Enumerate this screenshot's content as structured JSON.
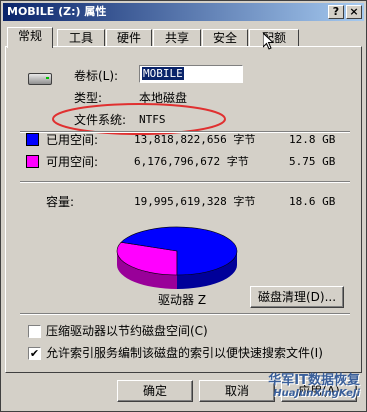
{
  "window": {
    "title": "MOBILE (Z:) 属性",
    "help_glyph": "?",
    "close_glyph": "×"
  },
  "tabs": [
    {
      "label": "常规"
    },
    {
      "label": "工具"
    },
    {
      "label": "硬件"
    },
    {
      "label": "共享"
    },
    {
      "label": "安全"
    },
    {
      "label": "配额"
    }
  ],
  "general": {
    "label_label": "卷标(L):",
    "label_value": "MOBILE",
    "type_label": "类型:",
    "type_value": "本地磁盘",
    "fs_label": "文件系统:",
    "fs_value": "NTFS",
    "used_label": "已用空间:",
    "used_bytes": "13,818,822,656 字节",
    "used_gb": "12.8 GB",
    "free_label": "可用空间:",
    "free_bytes": "6,176,796,672 字节",
    "free_gb": "5.75 GB",
    "capacity_label": "容量:",
    "capacity_bytes": "19,995,619,328 字节",
    "capacity_gb": "18.6 GB",
    "drive_label": "驱动器 Z",
    "cleanup_button": "磁盘清理(D)...",
    "compress_label": "压缩驱动器以节约磁盘空间(C)",
    "compress_checked": false,
    "index_label": "允许索引服务编制该磁盘的索引以便快速搜索文件(I)",
    "index_checked": true
  },
  "pie": {
    "used_fraction": 0.691,
    "used_color": "#0000ff",
    "free_color": "#ff00ff"
  },
  "buttons": {
    "ok": "确定",
    "cancel": "取消",
    "apply": "应用(A)"
  },
  "watermark": {
    "line1": "华军IT数据恢复",
    "line2": "HuaJunXingKeJi"
  },
  "annotation_color": "#e03030"
}
